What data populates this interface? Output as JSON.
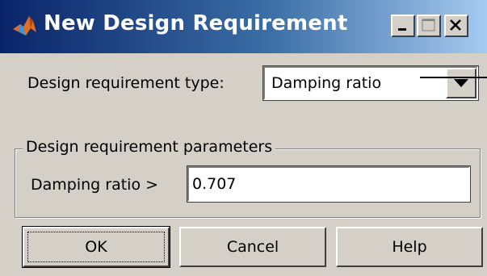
{
  "window": {
    "title": "New Design Requirement",
    "icon": "matlab-logo-icon",
    "controls": {
      "minimize": "minimize-icon",
      "maximize": "maximize-icon",
      "close": "close-icon"
    },
    "colors": {
      "titlebar_start": "#0a246a",
      "titlebar_end": "#a6caf0",
      "face": "#d4d0c8"
    }
  },
  "requirement_type": {
    "label": "Design requirement type:",
    "selected": "Damping ratio"
  },
  "parameters": {
    "group_title": "Design requirement parameters",
    "label": "Damping ratio  >",
    "value": "0.707"
  },
  "buttons": {
    "ok": "OK",
    "cancel": "Cancel",
    "help": "Help"
  }
}
